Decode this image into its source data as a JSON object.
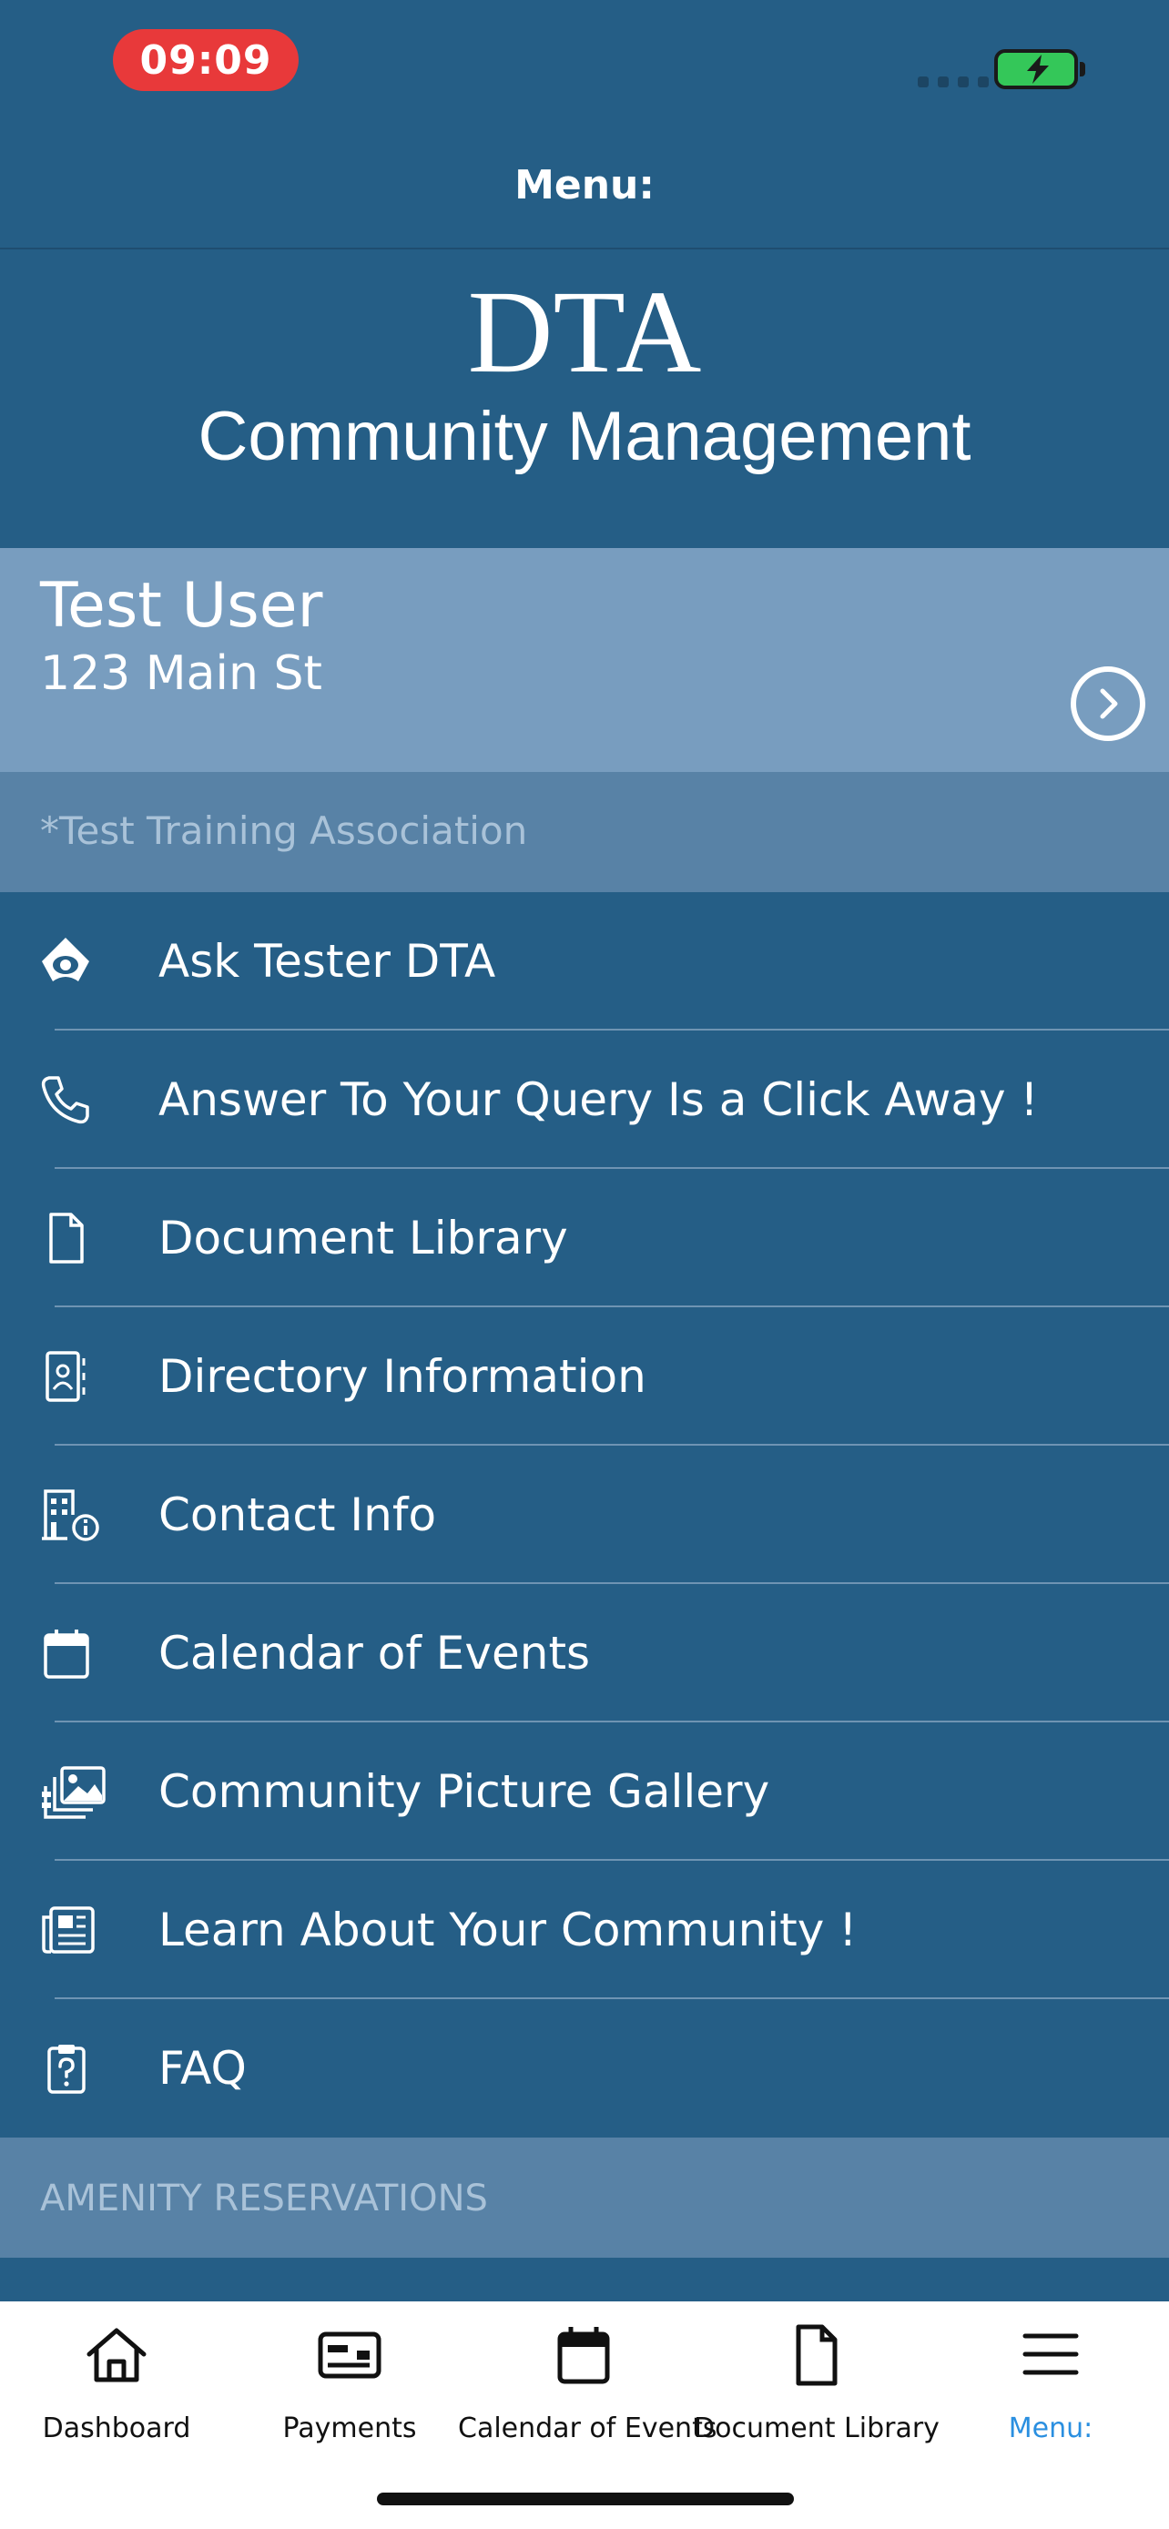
{
  "status_bar": {
    "time": "09:09",
    "battery_color": "#34c759"
  },
  "nav": {
    "title": "Menu:"
  },
  "brand": {
    "logo_text": "DTA",
    "subtitle": "Community Management"
  },
  "user": {
    "name": "Test User",
    "address": "123 Main St"
  },
  "association": {
    "label": "*Test Training Association"
  },
  "menu": {
    "items": [
      {
        "label": "Ask Tester DTA",
        "icon": "eye-logo-icon"
      },
      {
        "label": "Answer To Your Query Is a Click Away !",
        "icon": "phone-icon"
      },
      {
        "label": "Document Library",
        "icon": "document-icon"
      },
      {
        "label": "Directory Information",
        "icon": "address-book-icon"
      },
      {
        "label": "Contact Info",
        "icon": "building-info-icon"
      },
      {
        "label": "Calendar of Events",
        "icon": "calendar-icon"
      },
      {
        "label": "Community Picture Gallery",
        "icon": "photo-gallery-icon"
      },
      {
        "label": "Learn About Your Community !",
        "icon": "newspaper-icon"
      },
      {
        "label": "FAQ",
        "icon": "clipboard-question-icon"
      }
    ]
  },
  "amenity": {
    "header": "AMENITY RESERVATIONS"
  },
  "tabbar": {
    "tabs": [
      {
        "label": "Dashboard",
        "icon": "home-icon"
      },
      {
        "label": "Payments",
        "icon": "payments-icon"
      },
      {
        "label": "Calendar of Events",
        "icon": "calendar-icon"
      },
      {
        "label": "Document Library",
        "icon": "document-icon"
      },
      {
        "label": "Menu:",
        "icon": "hamburger-icon",
        "active": true
      }
    ],
    "active_color": "#2a8fe0"
  },
  "colors": {
    "background": "#255e86",
    "user_card": "#789dbf",
    "section": "#5882a6"
  }
}
